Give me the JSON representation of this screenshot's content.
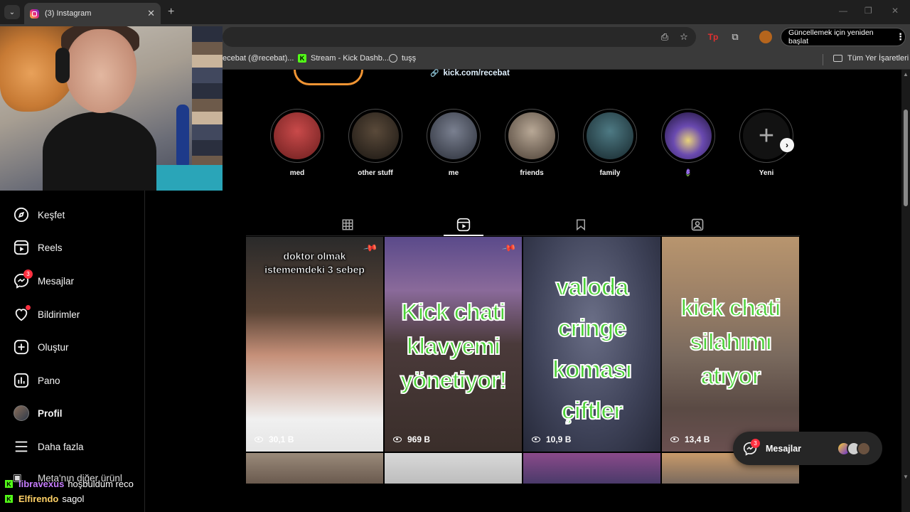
{
  "browser": {
    "tab_title": "(3) Instagram",
    "update_button": "Güncellemek için yeniden başlat",
    "bookmarks": [
      {
        "label": "ecebat (@recebat)..."
      },
      {
        "label": "Stream - Kick Dashb..."
      },
      {
        "label": "tuşş"
      }
    ],
    "all_bookmarks": "Tüm Yer İşaretleri"
  },
  "sidebar": {
    "items": [
      {
        "label": "Keşfet",
        "icon": "compass-icon"
      },
      {
        "label": "Reels",
        "icon": "reels-icon"
      },
      {
        "label": "Mesajlar",
        "icon": "messenger-icon",
        "badge": "3"
      },
      {
        "label": "Bildirimler",
        "icon": "heart-icon"
      },
      {
        "label": "Oluştur",
        "icon": "plus-square-icon"
      },
      {
        "label": "Pano",
        "icon": "chart-icon"
      },
      {
        "label": "Profil",
        "icon": "avatar"
      },
      {
        "label": "Daha fazla",
        "icon": "menu-icon"
      }
    ],
    "partial_item": "Meta'nın diğer ürünl"
  },
  "profile": {
    "link": "kick.com/recebat"
  },
  "highlights": [
    {
      "label": "med",
      "color": "#8b2b2b"
    },
    {
      "label": "other stuff",
      "color": "#3a3228"
    },
    {
      "label": "me",
      "color": "#4a4f5c"
    },
    {
      "label": "friends",
      "color": "#7a6a5a"
    },
    {
      "label": "family",
      "color": "#2f4a52"
    },
    {
      "label": "🪻",
      "color": "#3b2a6a"
    },
    {
      "label": "Yeni",
      "color": "#121212"
    }
  ],
  "reels": [
    {
      "caption": "doktor olmak\nistememdeki 3 sebep",
      "views": "30,1 B",
      "pinned": true
    },
    {
      "caption": "Kick chati\nklavyemi\nyönetiyor!",
      "views": "969 B",
      "pinned": true
    },
    {
      "caption": "valoda\ncringe\nkoması\nçiftler",
      "views": "10,9 B",
      "pinned": false
    },
    {
      "caption": "kick chati\nsilahımı\natıyor",
      "views": "13,4 B",
      "pinned": false
    }
  ],
  "messages_pill": {
    "label": "Mesajlar",
    "badge": "3"
  },
  "chat": [
    {
      "user": "libravexus",
      "text": "hoşbuldum reco",
      "color": "#c77dff"
    },
    {
      "user": "Elfirendo",
      "text": "sagol",
      "color": "#ffd166"
    }
  ]
}
